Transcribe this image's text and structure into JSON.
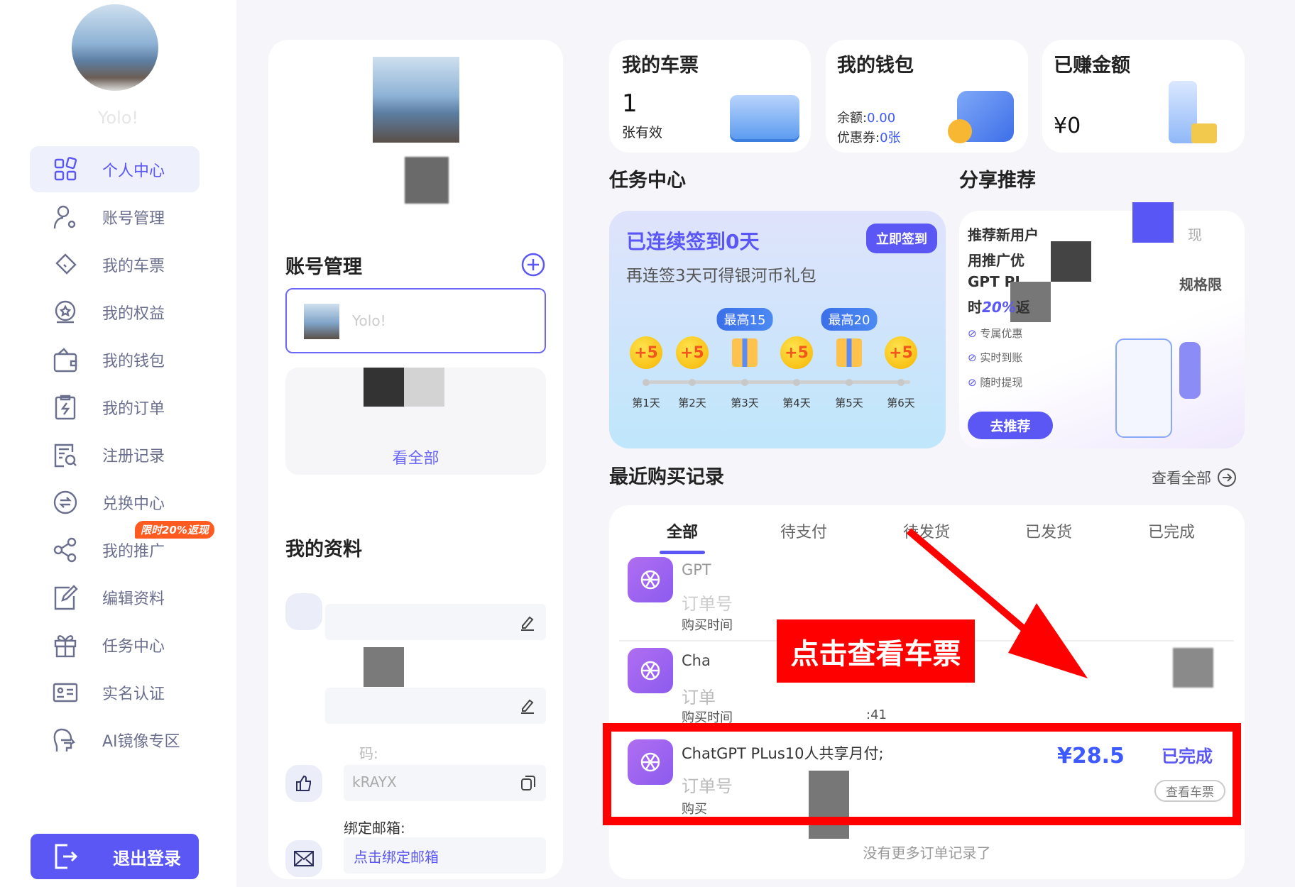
{
  "sidebar": {
    "username": "Yolo!",
    "items": [
      {
        "label": "个人中心",
        "icon": "dashboard-icon",
        "active": true
      },
      {
        "label": "账号管理",
        "icon": "user-settings-icon"
      },
      {
        "label": "我的车票",
        "icon": "ticket-icon"
      },
      {
        "label": "我的权益",
        "icon": "benefit-icon"
      },
      {
        "label": "我的钱包",
        "icon": "wallet-icon"
      },
      {
        "label": "我的订单",
        "icon": "order-icon"
      },
      {
        "label": "注册记录",
        "icon": "search-doc-icon"
      },
      {
        "label": "兑换中心",
        "icon": "exchange-icon"
      },
      {
        "label": "我的推广",
        "icon": "share-icon"
      },
      {
        "label": "编辑资料",
        "icon": "edit-icon"
      },
      {
        "label": "任务中心",
        "icon": "gift-icon"
      },
      {
        "label": "实名认证",
        "icon": "id-card-icon"
      },
      {
        "label": "AI镜像专区",
        "icon": "ai-head-icon"
      }
    ],
    "promo_badge": "限时20%返现",
    "logout_label": "退出登录"
  },
  "profile": {
    "account_heading": "账号管理",
    "account_name": "Yolo!",
    "view_all": "看全部",
    "info_heading": "我的资料",
    "code_label": "码:",
    "code_value": "kRAYX",
    "email_label": "绑定邮箱:",
    "email_link": "点击绑定邮箱"
  },
  "stats": {
    "tickets": {
      "title": "我的车票",
      "value": "1",
      "sub": "张有效"
    },
    "wallet": {
      "title": "我的钱包",
      "balance_label": "余额:",
      "balance": "0.00",
      "coupon_label": "优惠券:",
      "coupon": "0张"
    },
    "earned": {
      "title": "已赚金额",
      "value": "¥0"
    }
  },
  "tasks": {
    "heading": "任务中心",
    "streak": "已连续签到0天",
    "signin_button": "立即签到",
    "hint": "再连签3天可得银河币礼包",
    "days": [
      {
        "label": "第1天",
        "reward": "+5"
      },
      {
        "label": "第2天",
        "reward": "+5"
      },
      {
        "label": "第3天",
        "reward": "gift",
        "tip": "最高15"
      },
      {
        "label": "第4天",
        "reward": "+5"
      },
      {
        "label": "第5天",
        "reward": "gift",
        "tip": "最高20"
      },
      {
        "label": "第6天",
        "reward": "+5"
      }
    ]
  },
  "share": {
    "heading": "分享推荐",
    "lines": [
      "推荐新用户",
      "现",
      "用推广优",
      "GPT PL",
      "规格限",
      "时",
      "20%",
      "返"
    ],
    "checks": [
      "专属优惠",
      "实时到账",
      "随时提现"
    ],
    "button": "去推荐"
  },
  "orders": {
    "heading": "最近购买记录",
    "view_all": "查看全部",
    "tabs": [
      "全部",
      "待支付",
      "待发货",
      "已发货",
      "已完成"
    ],
    "active_tab": 0,
    "rows": [
      {
        "title": "GPT",
        "order_label": "订单号",
        "time_label": "购买时间"
      },
      {
        "title": "Cha",
        "order_label": "订单",
        "time_label": "购买时间",
        "time": ":41"
      },
      {
        "title": "ChatGPT PLus10人共享月付;",
        "order_label": "订单号",
        "time_label": "购买",
        "price": "¥28.5",
        "status": "已完成",
        "action": "查看车票"
      }
    ],
    "footer": "没有更多订单记录了"
  },
  "annotation": {
    "label": "点击查看车票",
    "color": "#ff0000"
  },
  "colors": {
    "accent": "#5b57f5",
    "price": "#3d5afe"
  }
}
